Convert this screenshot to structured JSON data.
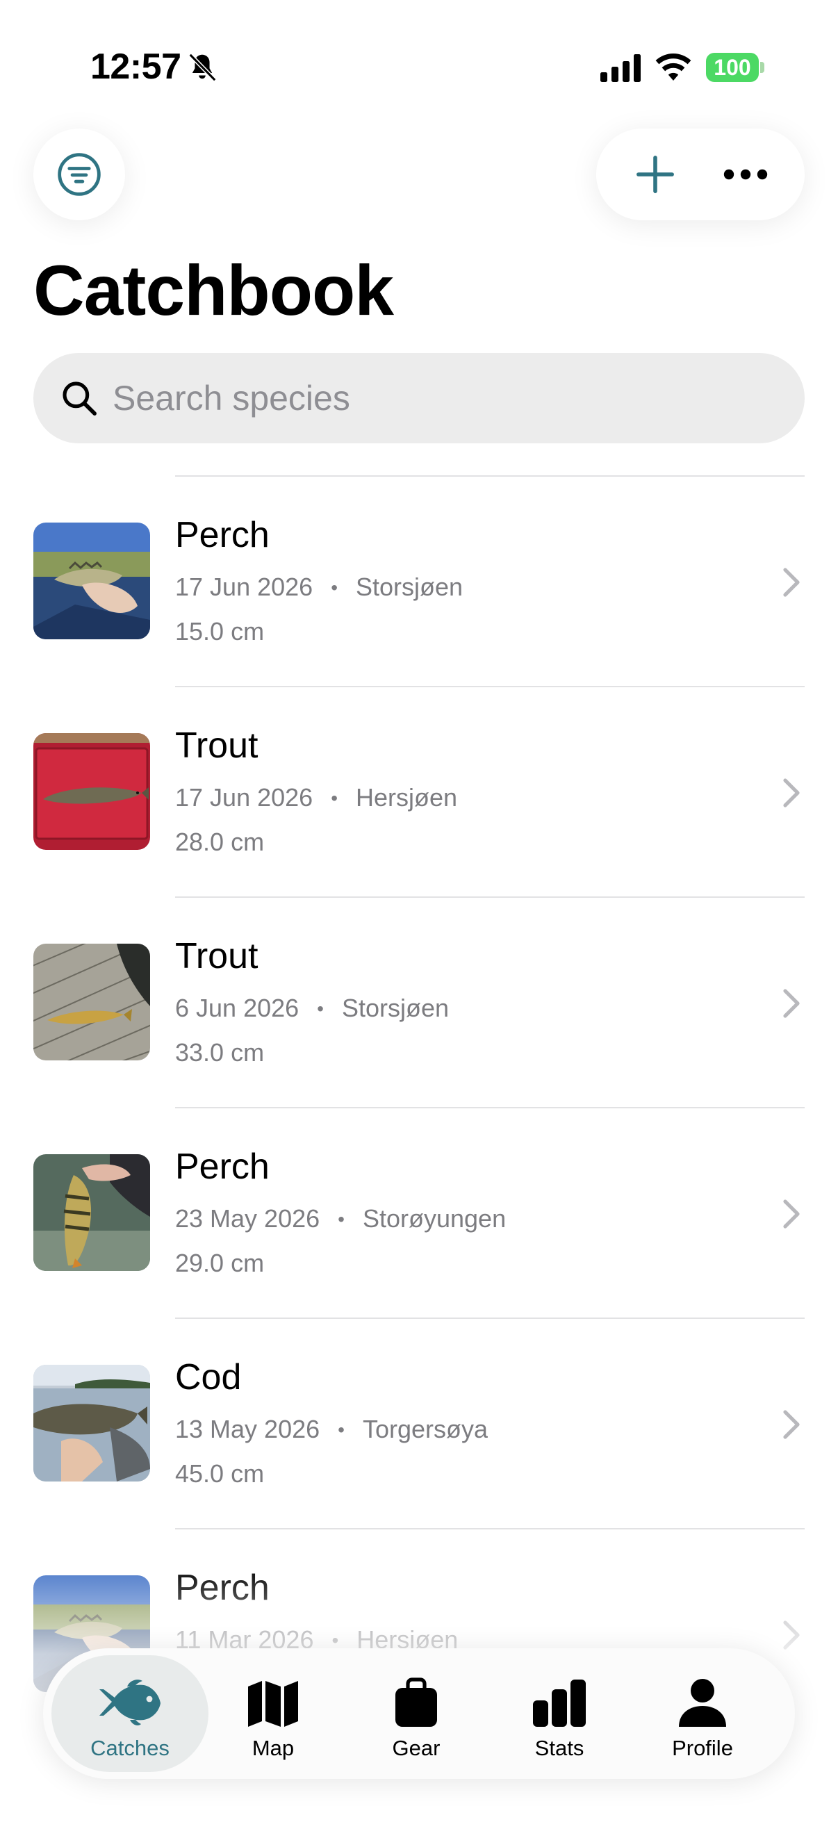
{
  "status_bar": {
    "time": "12:57",
    "battery": "100"
  },
  "header": {
    "title": "Catchbook"
  },
  "search": {
    "placeholder": "Search species",
    "value": ""
  },
  "catches": [
    {
      "species": "Perch",
      "date": "17 Jun 2026",
      "location": "Storsjøen",
      "length": "15.0 cm",
      "photo": "perch-lake"
    },
    {
      "species": "Trout",
      "date": "17 Jun 2026",
      "location": "Hersjøen",
      "length": "28.0 cm",
      "photo": "trout-red-tray"
    },
    {
      "species": "Trout",
      "date": "6 Jun 2026",
      "location": "Storsjøen",
      "length": "33.0 cm",
      "photo": "trout-dock"
    },
    {
      "species": "Perch",
      "date": "23 May 2026",
      "location": "Storøyungen",
      "length": "29.0 cm",
      "photo": "perch-held"
    },
    {
      "species": "Cod",
      "date": "13 May 2026",
      "location": "Torgersøya",
      "length": "45.0 cm",
      "photo": "cod-shore"
    },
    {
      "species": "Perch",
      "date": "11 Mar 2026",
      "location": "Hersjøen",
      "length": "",
      "photo": "perch-lake"
    }
  ],
  "tabs": [
    {
      "label": "Catches",
      "icon": "fish-icon",
      "active": true
    },
    {
      "label": "Map",
      "icon": "map-icon",
      "active": false
    },
    {
      "label": "Gear",
      "icon": "bag-icon",
      "active": false
    },
    {
      "label": "Stats",
      "icon": "bar-chart-icon",
      "active": false
    },
    {
      "label": "Profile",
      "icon": "person-icon",
      "active": false
    }
  ],
  "colors": {
    "accent": "#2f7483",
    "battery": "#4cd964",
    "secondary_text": "#7c7c80"
  }
}
